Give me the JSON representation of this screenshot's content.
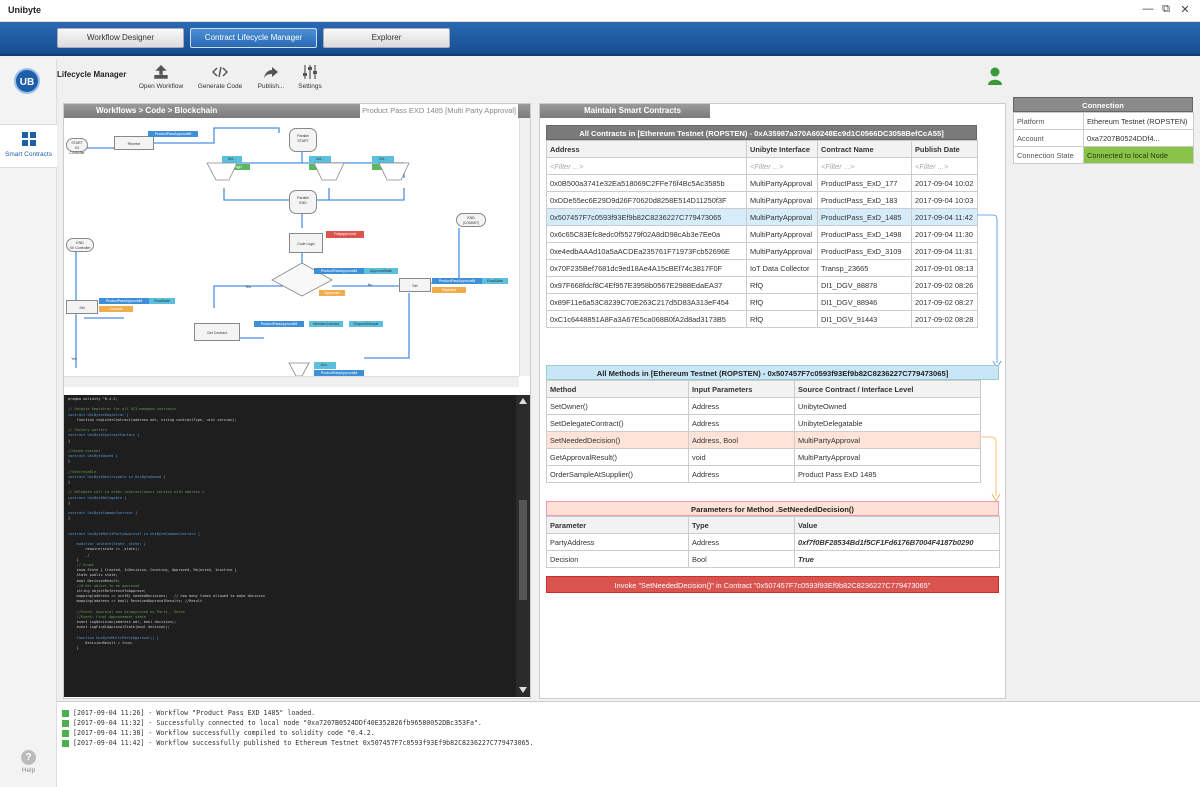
{
  "app": {
    "title": "Unibyte",
    "win_min": "—",
    "win_max": "⧉",
    "win_close": "✕"
  },
  "nav": {
    "tabs": [
      "Workflow Designer",
      "Contract Lifecycle Manager",
      "Explorer"
    ],
    "active": 1
  },
  "sidebar": {
    "logo": "UB",
    "smart_contracts": "Smart Contracts",
    "help": "Help",
    "help_glyph": "?"
  },
  "toolbar": {
    "title": "Lifecycle Manager",
    "buttons": [
      {
        "label": "Open Workflow",
        "icon": "upload-icon"
      },
      {
        "label": "Generate Code",
        "icon": "code-icon"
      },
      {
        "label": "Publish...",
        "icon": "share-arrow-icon"
      },
      {
        "label": "Settings",
        "icon": "sliders-icon"
      }
    ]
  },
  "workflow_panel": {
    "header": "Workflows > Code > Blockchain",
    "subtitle": "Product Pass EXD 1485   [Multi Party Approval]",
    "diagram": {
      "start": "START",
      "start_sub": "XX Controller",
      "receive": "Receive",
      "parallel_start": "Parallel\nSTART",
      "t1": "Set...",
      "t1b": "\"Design\"",
      "t2": "Ind...",
      "t2b": "\"Functionary\"",
      "t3": "Cre...",
      "t3b": "\"Shifting\"",
      "parallel_end": "Parallel\nEND",
      "end_left": "END",
      "end_left_sub": "XX Controller",
      "end_right": "END",
      "end_right_sub": "(COMMIT)",
      "code_logic": "Code Logic",
      "fullyapprove": "Fullyapproved",
      "approved": "Approved",
      "decision": "fullyneed?",
      "yes": "Yes",
      "no": "No",
      "set_left": "Set",
      "set_right": "Set",
      "get_contract": "Get Contract",
      "tag_pp": "ProductPassApprovalM",
      "tag_final": "FinalState",
      "tag_approval": "ApprovalState",
      "tag_contract": "Contract",
      "tag_rejected": "Rejected",
      "tag_member": "MemberContract",
      "tag_request": "RequestSample",
      "tag_ord": "Ord...",
      "tag_yes2": "Yes"
    },
    "code_lines": [
      {
        "t": "pragma solidity ^0.4.2;",
        "c": ""
      },
      {
        "t": "",
        "c": ""
      },
      {
        "t": "// Unibyte Registrar for all UI3-managed contracts",
        "c": "cm"
      },
      {
        "t": "contract UniBytesRegistrar {",
        "c": "kw"
      },
      {
        "t": "    function registerContract(address adr, string contractType, uint version);",
        "c": ""
      },
      {
        "t": "",
        "c": ""
      },
      {
        "t": "// Factory pattern",
        "c": "cm"
      },
      {
        "t": "contract UniByteContractFactory {",
        "c": "kw"
      },
      {
        "t": "}",
        "c": ""
      },
      {
        "t": "",
        "c": ""
      },
      {
        "t": "//Owned concept",
        "c": "cm"
      },
      {
        "t": "contract UniByteOwned {",
        "c": "kw"
      },
      {
        "t": "}",
        "c": ""
      },
      {
        "t": "",
        "c": ""
      },
      {
        "t": "//Destroyable",
        "c": "cm"
      },
      {
        "t": "contract UniByteDestroyable is UniByteOwned {",
        "c": "kw"
      },
      {
        "t": "}",
        "c": ""
      },
      {
        "t": "",
        "c": ""
      },
      {
        "t": "// Delegate call to other contract/owner version with address x",
        "c": "cm"
      },
      {
        "t": "contract UniByteDelegable {",
        "c": "kw"
      },
      {
        "t": "}",
        "c": ""
      },
      {
        "t": "",
        "c": ""
      },
      {
        "t": "contract UniByteCommonContract {",
        "c": "kw"
      },
      {
        "t": "}",
        "c": ""
      },
      {
        "t": "",
        "c": ""
      },
      {
        "t": "",
        "c": ""
      },
      {
        "t": "contract UniByteMultiPartyApproval is UniByteCommonContract {",
        "c": "kw"
      },
      {
        "t": "",
        "c": ""
      },
      {
        "t": "    modifier inState(State _state) {",
        "c": "kw"
      },
      {
        "t": "        require(state == _state);",
        "c": ""
      },
      {
        "t": "        _;",
        "c": ""
      },
      {
        "t": "    }",
        "c": ""
      },
      {
        "t": "    // Enums",
        "c": "cm"
      },
      {
        "t": "    enum State { Created, InDecision, Counting, Approved, Rejected, Inactive }",
        "c": ""
      },
      {
        "t": "    State public state;",
        "c": ""
      },
      {
        "t": "    bool DecisionResult;",
        "c": ""
      },
      {
        "t": "    //# Her object to be approved",
        "c": "cm"
      },
      {
        "t": "    string objectReferenceToApprove;",
        "c": ""
      },
      {
        "t": "    mapping(address => uint8) neededDecisions;   // how many times allowed to make decision",
        "c": ""
      },
      {
        "t": "    mapping(address => bool) ReceivedApprovalResults; //Result",
        "c": ""
      },
      {
        "t": "",
        "c": ""
      },
      {
        "t": "    //Event: Approval was disapproved by Party - Share",
        "c": "cm"
      },
      {
        "t": "    //Event: Final Approvement state",
        "c": "cm"
      },
      {
        "t": "    event LogDecision(address adr, bool decision);",
        "c": ""
      },
      {
        "t": "    event LogFinalApprovalState(bool decision);",
        "c": ""
      },
      {
        "t": "",
        "c": ""
      },
      {
        "t": "    function UniByteMultiPartyApproval() {",
        "c": "kw"
      },
      {
        "t": "        DecisionResult = true;",
        "c": ""
      },
      {
        "t": "    }",
        "c": ""
      }
    ]
  },
  "contracts_panel": {
    "header": "Maintain Smart Contracts",
    "all_contracts_caption": "All Contracts in [Ethereum Testnet (ROPSTEN) - 0xA35987a370A60248Ec9d1C0566DC3058BefCcA55]",
    "columns": [
      "Address",
      "Unibyte Interface",
      "Contract Name",
      "Publish Date"
    ],
    "filter": "<Filter ...>",
    "rows": [
      [
        "0x0B500a3741e32Ea518069C2FFe76f4Bc5Ac3585b",
        "MultiPartyApproval",
        "ProductPass_ExD_177",
        "2017-09-04 10:02"
      ],
      [
        "0xDDe55ec6E29D9d26F70620d8258E514D11250f3F",
        "MultiPartyApproval",
        "ProductPass_ExD_183",
        "2017-09-04 10:03"
      ],
      [
        "0x507457F7c0593f93Ef9b82C8236227C779473065",
        "MultiPartyApproval",
        "ProductPass_ExD_1485",
        "2017-09-04 11:42"
      ],
      [
        "0x6c65C83Efc8edc0f55279f02A8dD98cAb3e7Ee0a",
        "MultiPartyApproval",
        "ProductPass_ExD_1498",
        "2017-09-04 11:30"
      ],
      [
        "0xe4edbAAAd10a5aACDEa235761F71973Fcb52696E",
        "MultiPartyApproval",
        "ProductPass_ExD_3109",
        "2017-09-04 11:31"
      ],
      [
        "0x70F235Bef7681dc9ed18Ae4A15cBEf74c3817F0F",
        "IoT Data Collector",
        "Transp_23665",
        "2017-09-01 08:13"
      ],
      [
        "0x97F668fdcf8C4Ef957E3958b0567E2988EdaEA37",
        "RfQ",
        "DI1_DGV_88878",
        "2017-09-02 08:26"
      ],
      [
        "0x89F11e6a53C8239C70E263C217d5D83A313eF454",
        "RfQ",
        "DI1_DGV_88946",
        "2017-09-02 08:27"
      ],
      [
        "0xC1c6448851A8Fa3A67E5ca068B0fA2d8ad3173B5",
        "RfQ",
        "DI1_DGV_91443",
        "2017-09-02 08:28"
      ]
    ],
    "selected_row": 2,
    "methods_caption": "All Methods in [Ethereum Testnet (ROPSTEN) - 0x507457F7c0593f93Ef9b82C8236227C779473065]",
    "method_columns": [
      "Method",
      "Input Parameters",
      "Source Contract / Interface Level"
    ],
    "methods": [
      [
        "SetOwner()",
        "Address",
        "UnibyteOwned"
      ],
      [
        "SetDelegateContract()",
        "Address",
        "UnibyteDelegatable"
      ],
      [
        "SetNeededDecision()",
        "Address, Bool",
        "MultiPartyApproval"
      ],
      [
        "GetApprovalResult()",
        "void",
        "MultiPartyApproval"
      ],
      [
        "OrderSampleAtSupplier()",
        "Address",
        "Product Pass ExD 1485"
      ]
    ],
    "selected_method": 2,
    "params_caption": "Parameters for Method .SetNeededDecision()",
    "param_columns": [
      "Parameter",
      "Type",
      "Value"
    ],
    "params": [
      [
        "PartyAddress",
        "Address",
        "0xf7f0BF28534Bd1f5CF1Fd6176B7004F4187b0290"
      ],
      [
        "Decision",
        "Bool",
        "True"
      ]
    ],
    "invoke_label": "Invoke \"SetNeededDecision()\" in Contract \"0x507457F7c0593f93Ef9b82C8236227C779473065\""
  },
  "connection": {
    "header": "Connection",
    "rows": [
      [
        "Platform",
        "Ethereum Testnet (ROPSTEN)"
      ],
      [
        "Account",
        "0xa7207B0524DDf4..."
      ],
      [
        "Connection State",
        "Connected to local Node"
      ]
    ]
  },
  "log": [
    "[2017-09-04 11:26] - Workflow \"Product Pass EXD 1485\" loaded.",
    "[2017-09-04 11:32] - Successfully connected to local node \"0xa7207B0524DDf40E352826fb96580052DBc353Fa\".",
    "[2017-09-04 11:38] - Workflow successfully compiled to solidity code  \"0.4.2.",
    "[2017-09-04 11:42] - Workflow successfully published to Ethereum Testnet 0x507457F7c0593f93Ef9b82C8236227C779473065."
  ],
  "colors": {
    "nav": "#1d5ea8",
    "accent": "#4a90e2",
    "ok": "#8bc34a",
    "invoke": "#d9534f",
    "user_icon": "#3a9a3a"
  }
}
